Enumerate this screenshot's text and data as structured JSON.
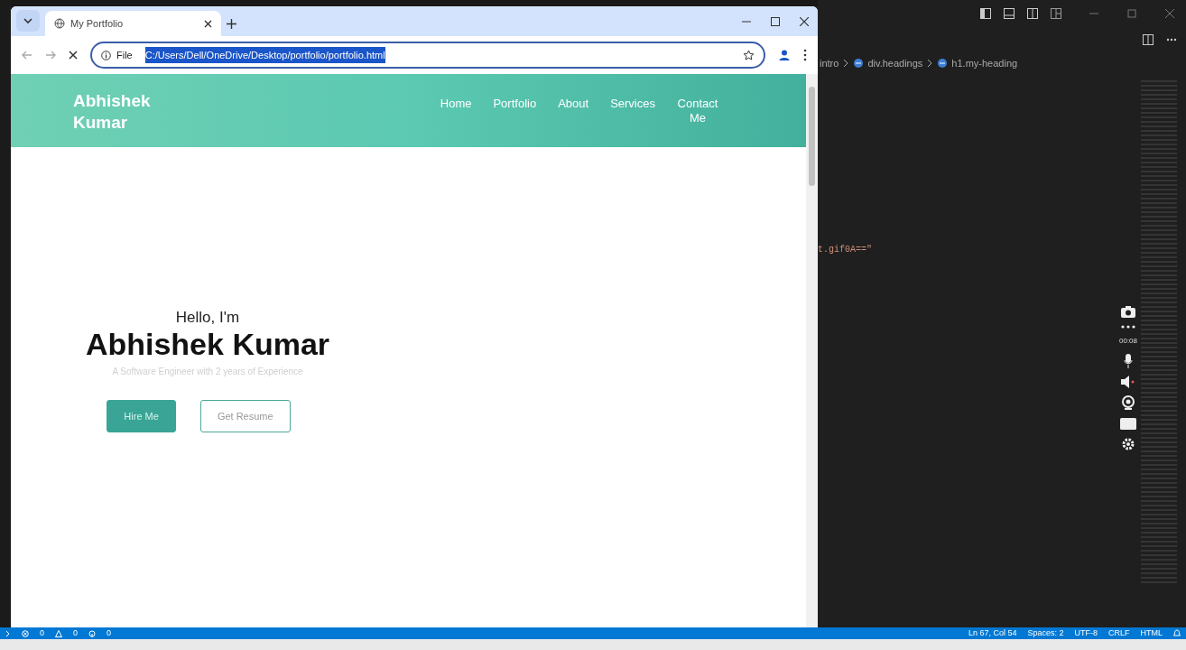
{
  "browser": {
    "tab": {
      "title": "My Portfolio"
    },
    "address": {
      "scheme": "File",
      "url": "C:/Users/Dell/OneDrive/Desktop/portfolio/portfolio.html",
      "selected": true
    }
  },
  "site": {
    "brand": "Abhishek Kumar",
    "nav": [
      {
        "label": "Home"
      },
      {
        "label": "Portfolio"
      },
      {
        "label": "About"
      },
      {
        "label": "Services"
      },
      {
        "label": "Contact Me"
      }
    ],
    "hero": {
      "greeting": "Hello, I'm",
      "name": "Abhishek Kumar",
      "tagline": "A Software Engineer with 2 years of Experience",
      "buttons": [
        {
          "label": "Hire Me",
          "kind": "primary"
        },
        {
          "label": "Get Resume",
          "kind": "outline"
        }
      ]
    }
  },
  "editor": {
    "breadcrumbs": [
      "intro",
      "div.headings",
      "h1.my-heading"
    ],
    "code_fragment": "t.gif0A==\"",
    "recorder": {
      "timer": "00:08"
    },
    "status_bar": {
      "errors": "0",
      "warnings": "0",
      "ports": "0",
      "items": [
        "Ln 67, Col 54",
        "Spaces: 2",
        "UTF-8",
        "CRLF",
        "HTML"
      ]
    }
  }
}
